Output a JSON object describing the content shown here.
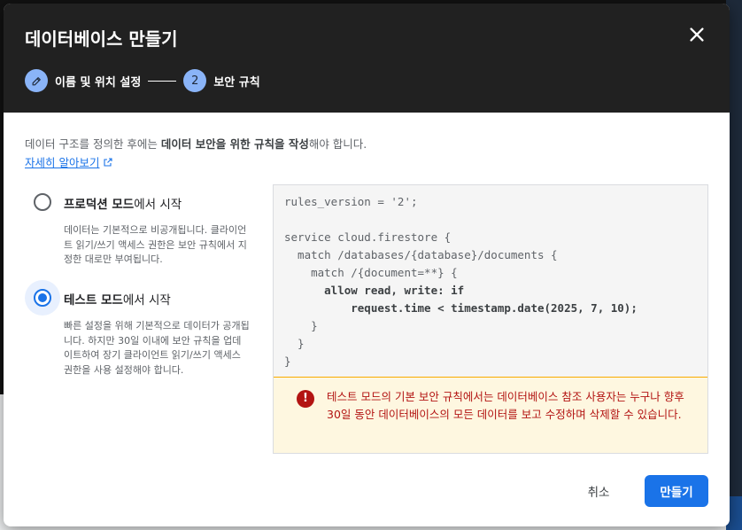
{
  "dialog": {
    "title": "데이터베이스 만들기",
    "close_icon": "close-icon"
  },
  "stepper": {
    "steps": [
      {
        "icon": "pencil-icon",
        "label": "이름 및 위치 설정",
        "state": "completed"
      },
      {
        "number": "2",
        "label": "보안 규칙",
        "state": "active"
      }
    ]
  },
  "intro": {
    "text_before": "데이터 구조를 정의한 후에는 ",
    "text_bold": "데이터 보안을 위한 규칙을 작성",
    "text_after": "해야 합니다.",
    "link_label": "자세히 알아보기",
    "link_icon": "open-in-new-icon"
  },
  "options": [
    {
      "title_bold": "프로덕션 모드",
      "title_rest": "에서 시작",
      "description": "데이터는 기본적으로 비공개됩니다. 클라이언트 읽기/쓰기 액세스 권한은 보안 규칙에서 지정한 대로만 부여됩니다.",
      "selected": false
    },
    {
      "title_bold": "테스트 모드",
      "title_rest": "에서 시작",
      "description": "빠른 설정을 위해 기본적으로 데이터가 공개됩니다. 하지만 30일 이내에 보안 규칙을 업데이트하여 장기 클라이언트 읽기/쓰기 액세스 권한을 사용 설정해야 합니다.",
      "selected": true
    }
  ],
  "rules": {
    "lines": [
      "rules_version = '2';",
      "",
      "service cloud.firestore {",
      "  match /databases/{database}/documents {",
      "    match /{document=**} {",
      "      allow read, write: if",
      "          request.time < timestamp.date(2025, 7, 10);",
      "    }",
      "  }",
      "}"
    ],
    "warning_icon": "error-icon",
    "warning_text": "테스트 모드의 기본 보안 규칙에서는 데이터베이스 참조 사용자는 누구나 향후 30일 동안 데이터베이스의 모든 데이터를 보고 수정하며 삭제할 수 있습니다."
  },
  "actions": {
    "cancel_label": "취소",
    "create_label": "만들기"
  },
  "colors": {
    "header_bg": "#212121",
    "step_circle": "#8ab4f8",
    "accent": "#1a73e8",
    "warning_text": "#b31412",
    "warning_bg": "#fef7e0"
  }
}
